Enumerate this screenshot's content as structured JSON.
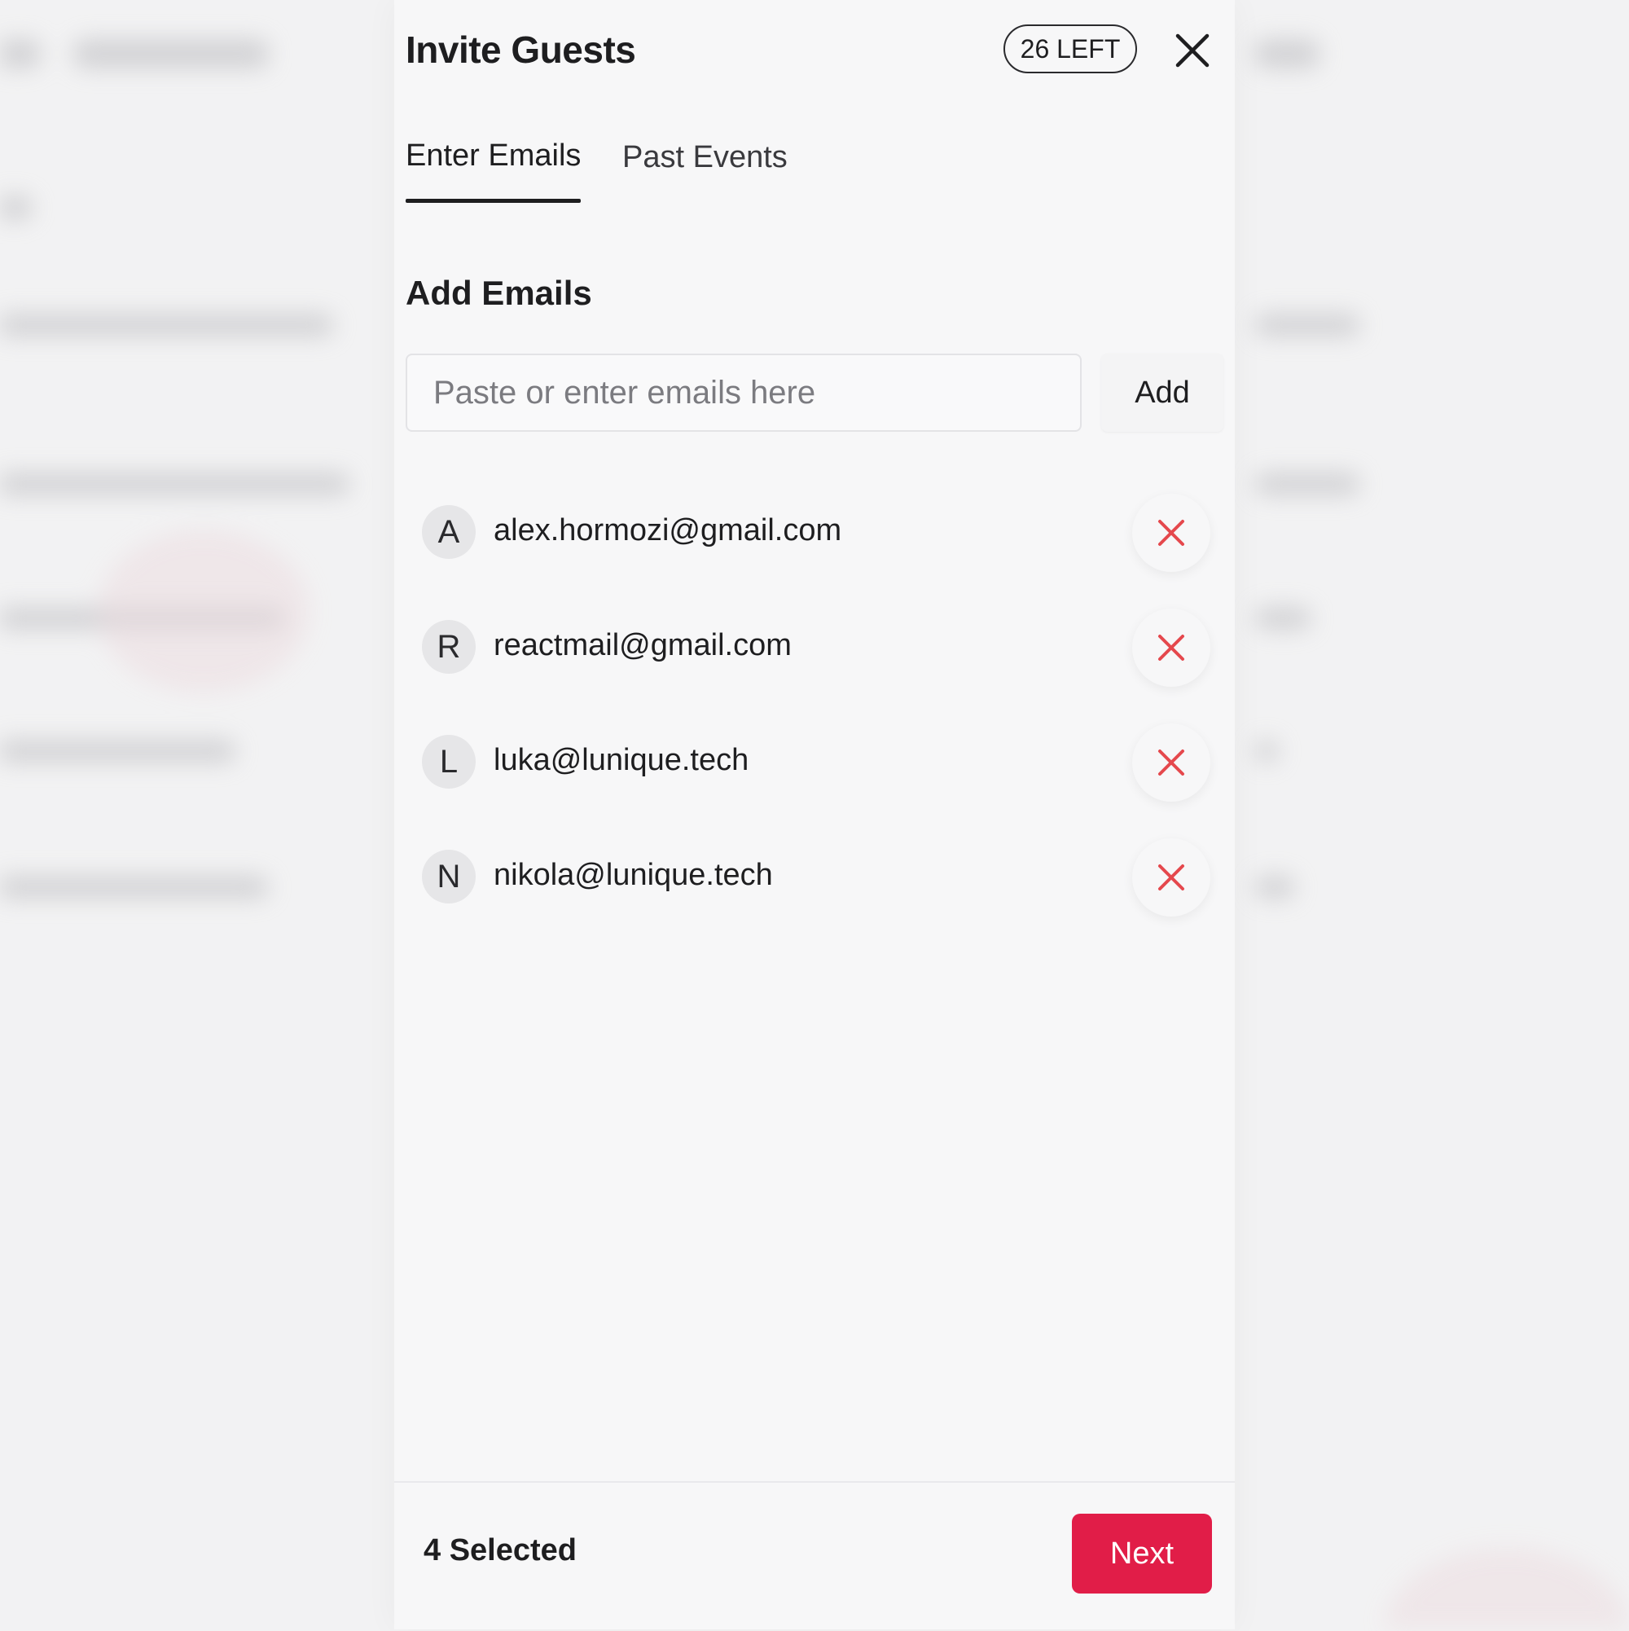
{
  "modal": {
    "title": "Invite Guests",
    "remaining_badge": "26 LEFT",
    "close_icon": "close-icon"
  },
  "tabs": [
    {
      "label": "Enter Emails",
      "active": true
    },
    {
      "label": "Past Events",
      "active": false
    }
  ],
  "add_section": {
    "heading": "Add Emails",
    "input_value": "",
    "input_placeholder": "Paste or enter emails here",
    "add_label": "Add"
  },
  "emails": [
    {
      "initial": "A",
      "address": "alex.hormozi@gmail.com",
      "remove_icon": "x-icon"
    },
    {
      "initial": "R",
      "address": "reactmail@gmail.com",
      "remove_icon": "x-icon"
    },
    {
      "initial": "L",
      "address": "luka@lunique.tech",
      "remove_icon": "x-icon"
    },
    {
      "initial": "N",
      "address": "nikola@lunique.tech",
      "remove_icon": "x-icon"
    }
  ],
  "footer": {
    "selected_text": "4 Selected",
    "next_label": "Next"
  },
  "colors": {
    "accent": "#e11d48",
    "remove_icon": "#e5484d",
    "text": "#1e1e20",
    "panel": "#f7f7f8"
  }
}
